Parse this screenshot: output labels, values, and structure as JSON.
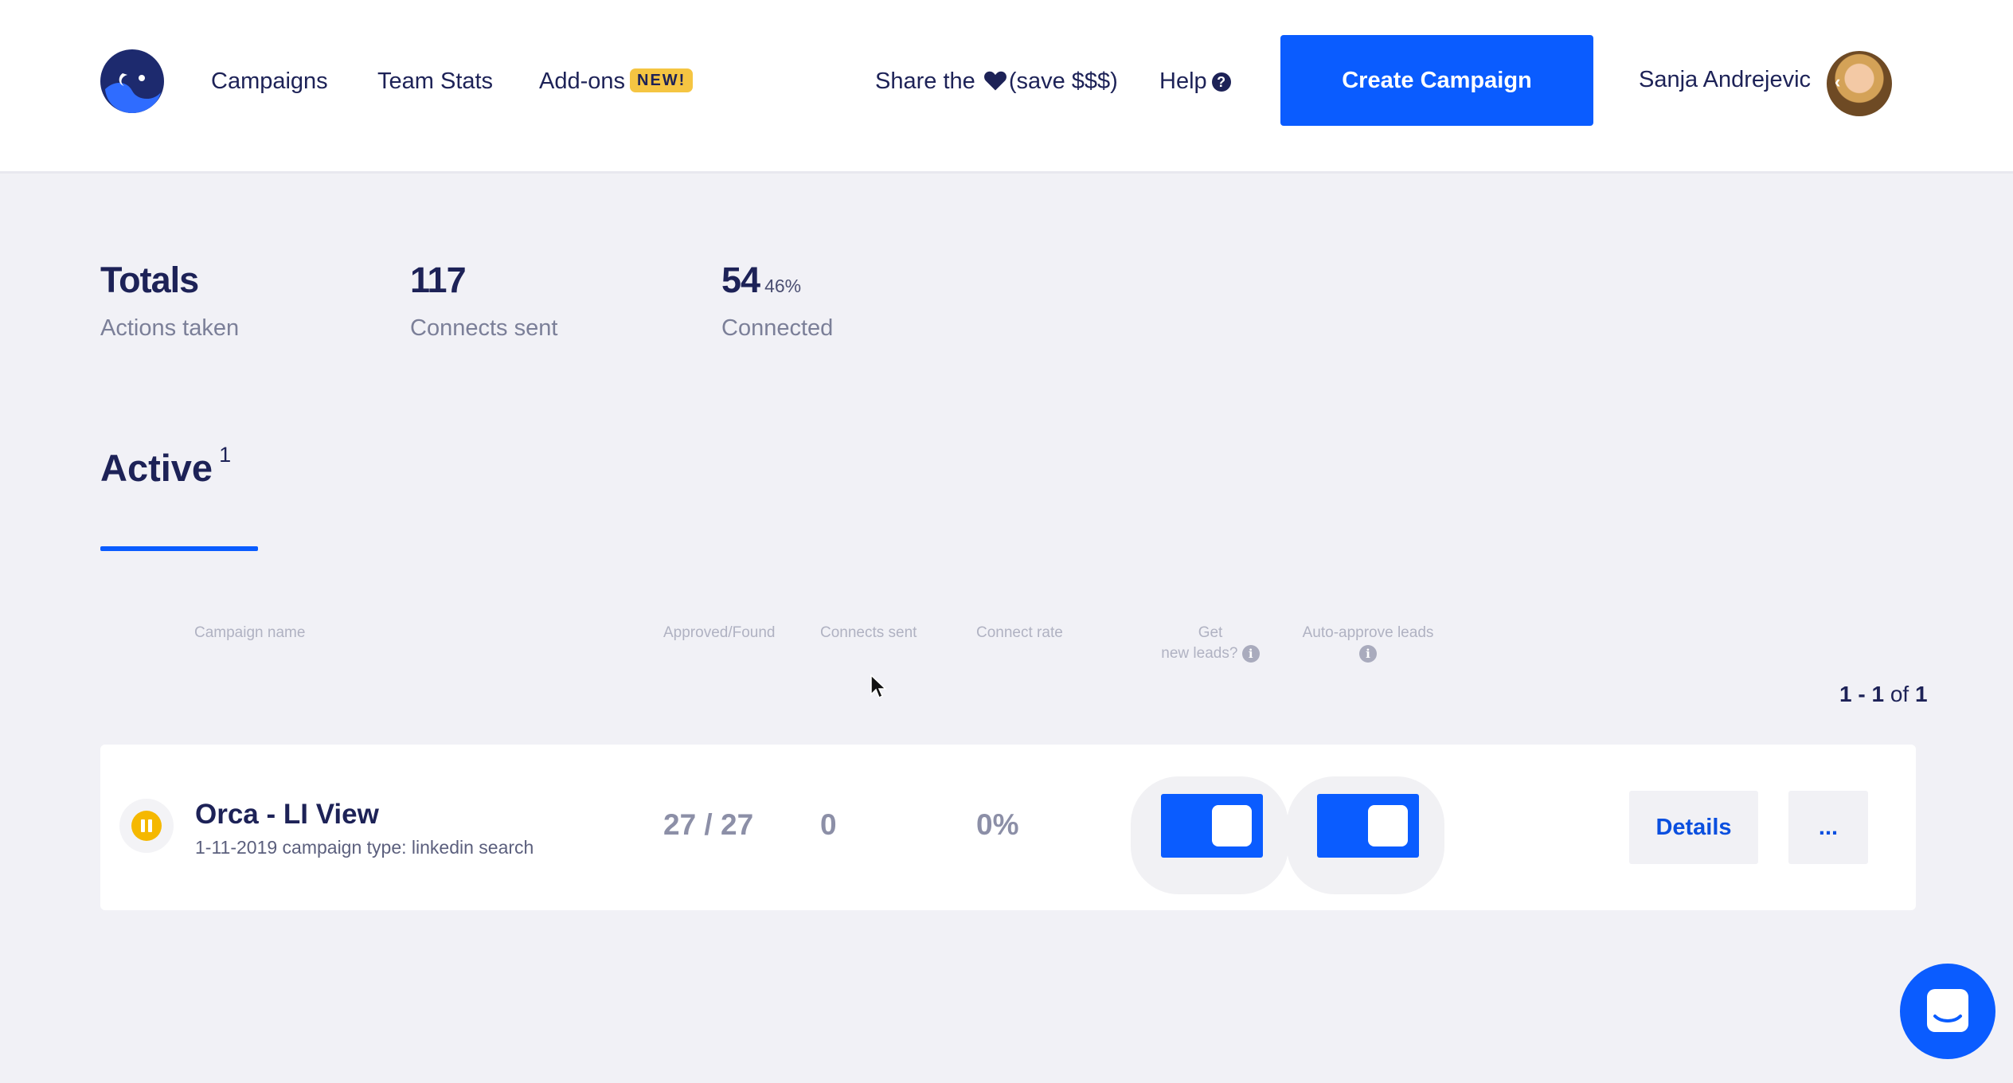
{
  "header": {
    "nav": {
      "campaigns": "Campaigns",
      "team_stats": "Team Stats",
      "addons": "Add-ons",
      "addons_badge": "NEW!"
    },
    "share_prefix": "Share the",
    "share_suffix": "(save $$$)",
    "help": "Help",
    "create_button": "Create Campaign",
    "user_name": "Sanja Andrejevic"
  },
  "stats": {
    "totals_value": "Totals",
    "totals_label": "Actions taken",
    "connects_value": "117",
    "connects_label": "Connects sent",
    "connected_value": "54",
    "connected_pct": "46%",
    "connected_label": "Connected"
  },
  "tab": {
    "label": "Active",
    "count": "1"
  },
  "columns": {
    "name": "Campaign name",
    "approved": "Approved/Found",
    "connects": "Connects sent",
    "rate": "Connect rate",
    "get_leads_1": "Get",
    "get_leads_2": "new leads?",
    "auto_approve": "Auto-approve leads"
  },
  "pagination": {
    "range": "1 - 1",
    "of": "of",
    "total": "1"
  },
  "campaign": {
    "name": "Orca - LI View",
    "subtitle": "1-11-2019 campaign type: linkedin search",
    "approved_found": "27 / 27",
    "connects_sent": "0",
    "connect_rate": "0%",
    "get_new_leads": true,
    "auto_approve": true,
    "details": "Details",
    "more": "..."
  },
  "colors": {
    "accent": "#0a5cff",
    "text_dark": "#1d2257",
    "badge": "#f5c542",
    "pause": "#f5b800"
  }
}
